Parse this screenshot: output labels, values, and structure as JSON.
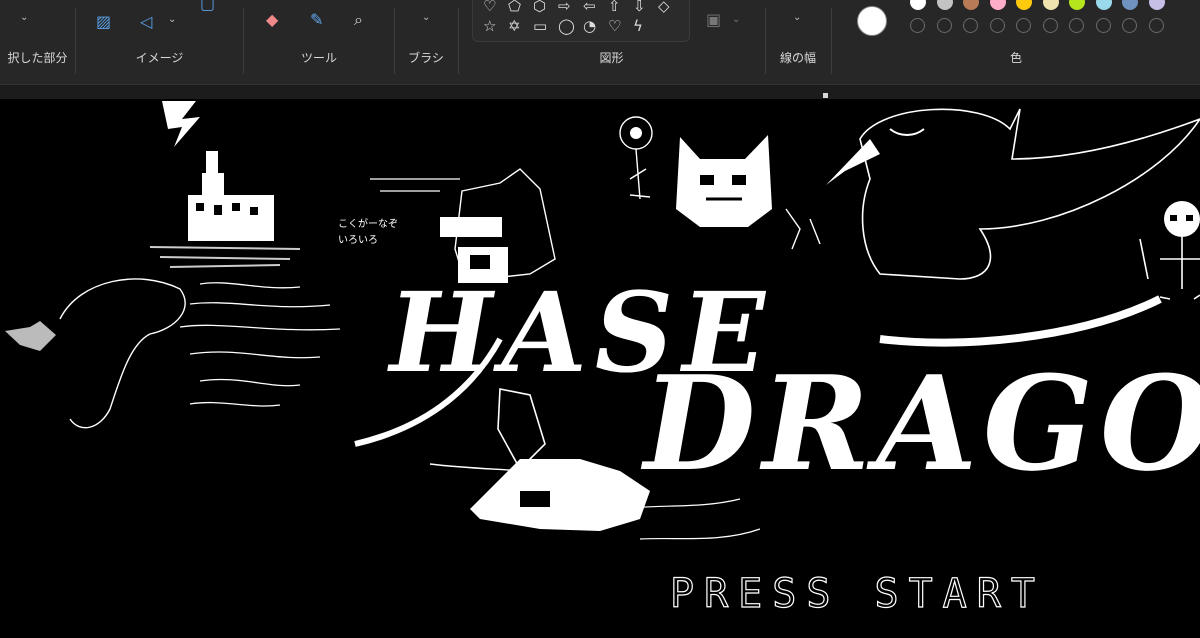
{
  "ribbon": {
    "groups": [
      {
        "label": "択した部分"
      },
      {
        "label": "イメージ"
      },
      {
        "label": "ツール"
      },
      {
        "label": "ブラシ"
      },
      {
        "label": "図形"
      },
      {
        "label": "線の幅"
      },
      {
        "label": "色"
      }
    ],
    "icons": {
      "selection_chevron": "chevron-down-icon",
      "image_resize": "resize-icon",
      "image_rotate": "rotate-icon",
      "image_extra": "image-icon",
      "eraser": "eraser-icon",
      "color_picker": "color-picker-icon",
      "magnifier": "magnifier-icon",
      "brush_chevron": "chevron-down-icon",
      "line_width_chevron": "chevron-down-icon",
      "fill": "fill-icon"
    },
    "shape_glyphs_row1": [
      "♡",
      "⬠",
      "⬡",
      "⇨",
      "⇦",
      "⇧",
      "⇩",
      "◇"
    ],
    "shape_glyphs_row2": [
      "☆",
      "✡",
      "▭",
      "◯",
      "◔",
      "♡",
      "ϟ"
    ],
    "primary_color": "#ffffff",
    "palette_row1": [
      "#ffffff",
      "#c3c3c3",
      "#b97a57",
      "#ffaec9",
      "#ffc90e",
      "#efe4b0",
      "#b5e61d",
      "#99d9ea",
      "#7092be",
      "#c8bfe7"
    ],
    "palette_row2_count": 10
  },
  "canvas": {
    "title_line1": "HASE",
    "title_line2": "DRAGO",
    "press_start": "PRESS START",
    "note_lines": [
      "こくがーなぞ",
      "いろいろ"
    ]
  }
}
